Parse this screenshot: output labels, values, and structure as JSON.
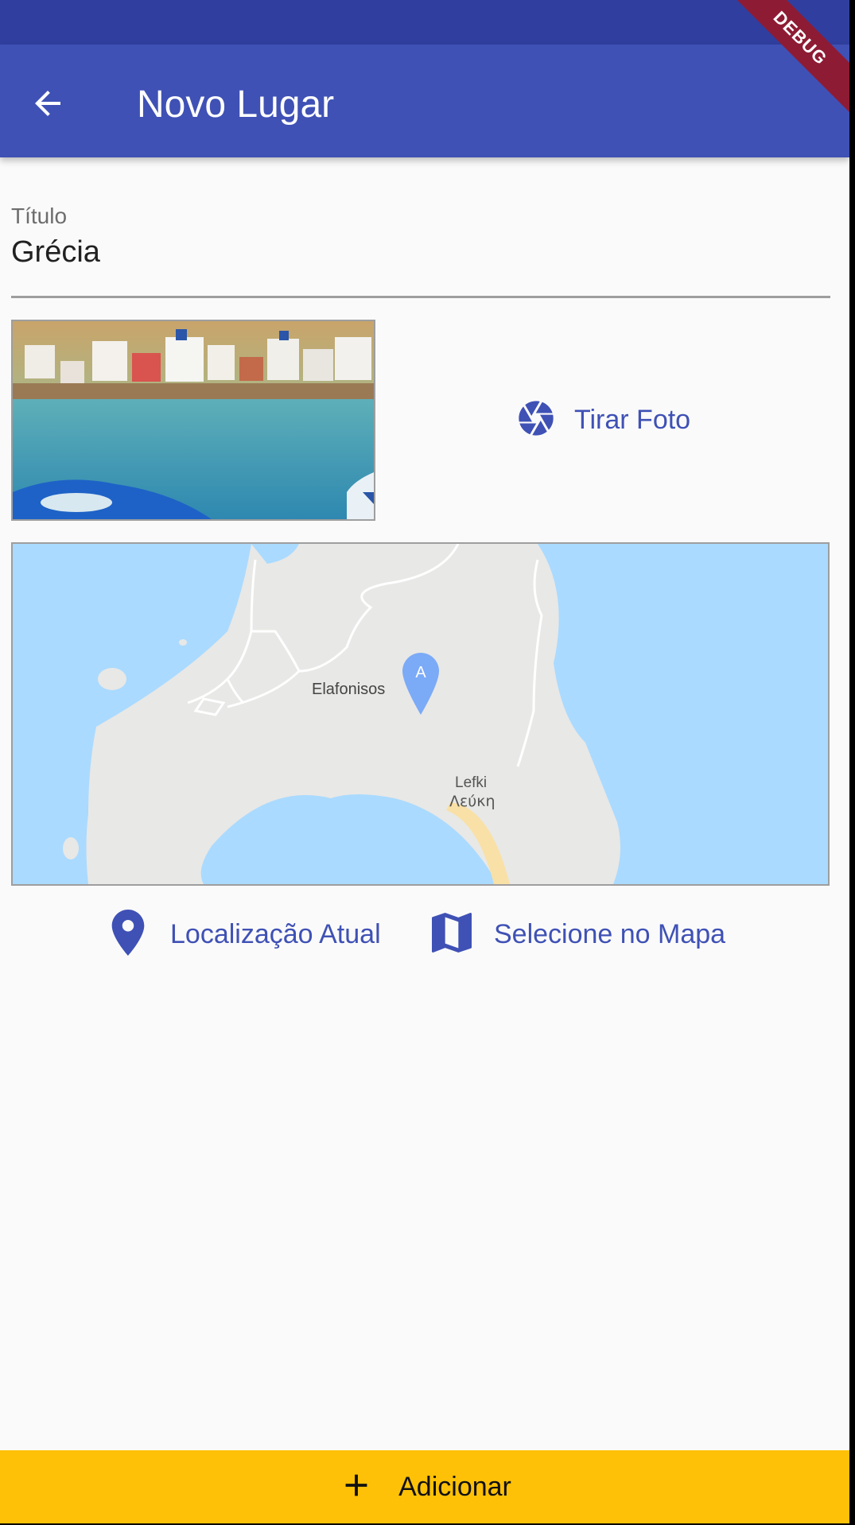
{
  "app_bar": {
    "title": "Novo Lugar",
    "back_icon": "arrow-back-icon",
    "color": "#3f51b5",
    "status_bar_color": "#303f9f"
  },
  "debug_banner": {
    "label": "DEBUG",
    "color": "#8e1b34"
  },
  "form": {
    "title_field": {
      "label": "Título",
      "value": "Grécia"
    }
  },
  "image_input": {
    "take_photo_label": "Tirar Foto",
    "take_photo_icon": "camera-shutter-icon"
  },
  "map": {
    "place_label": "Elafonisos",
    "beach_label_latin": "Lefki",
    "beach_label_greek": "Λεύκη",
    "marker_letter": "A"
  },
  "location_input": {
    "current_location_label": "Localização Atual",
    "current_location_icon": "location-pin-icon",
    "select_map_label": "Selecione no Mapa",
    "select_map_icon": "map-icon",
    "accent_color": "#3f51b5"
  },
  "submit": {
    "label": "Adicionar",
    "icon": "plus-icon",
    "color": "#ffc107"
  }
}
